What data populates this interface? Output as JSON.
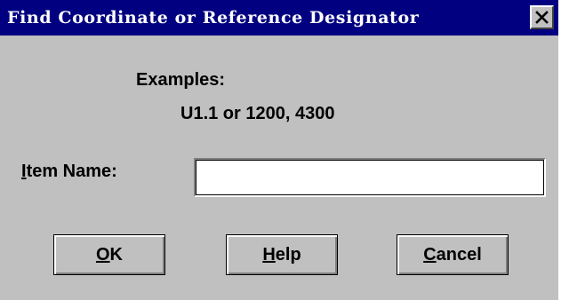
{
  "window": {
    "title": "Find Coordinate or Reference Designator",
    "close_symbol": "X"
  },
  "examples": {
    "heading": "Examples:",
    "text": "U1.1 or 1200, 4300"
  },
  "item_name": {
    "label_mnemonic": "I",
    "label_rest": "tem Name:",
    "value": ""
  },
  "buttons": {
    "ok": {
      "mnemonic": "O",
      "rest": "K"
    },
    "help": {
      "mnemonic": "H",
      "rest": "elp"
    },
    "cancel": {
      "mnemonic": "C",
      "rest": "ancel"
    }
  },
  "icons": {
    "close": "close-icon"
  },
  "colors": {
    "title_bar": "#000080",
    "dialog_face": "#c0c0c0",
    "input_background": "#ffffff"
  }
}
